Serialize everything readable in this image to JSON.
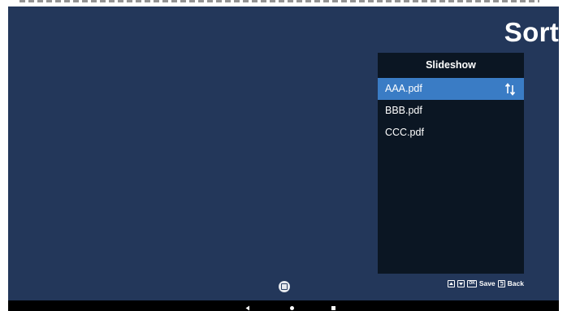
{
  "page": {
    "title": "Sort"
  },
  "panel": {
    "header": "Slideshow",
    "items": [
      {
        "label": "AAA.pdf",
        "selected": true
      },
      {
        "label": "BBB.pdf",
        "selected": false
      },
      {
        "label": "CCC.pdf",
        "selected": false
      }
    ]
  },
  "hints": {
    "keys": [
      "up-key-icon",
      "down-key-icon"
    ],
    "ok_key": "OK",
    "save_label": "Save",
    "back_label": "Back"
  },
  "icons": {
    "sort": "up-down-arrows-icon",
    "floating_button": "stop-square-icon",
    "nav": [
      "nav-back-icon",
      "nav-home-icon",
      "nav-recent-icon"
    ]
  },
  "colors": {
    "background": "#23375a",
    "panel": "#0b1623",
    "selection": "#3a7cc5",
    "navbar": "#000000"
  }
}
